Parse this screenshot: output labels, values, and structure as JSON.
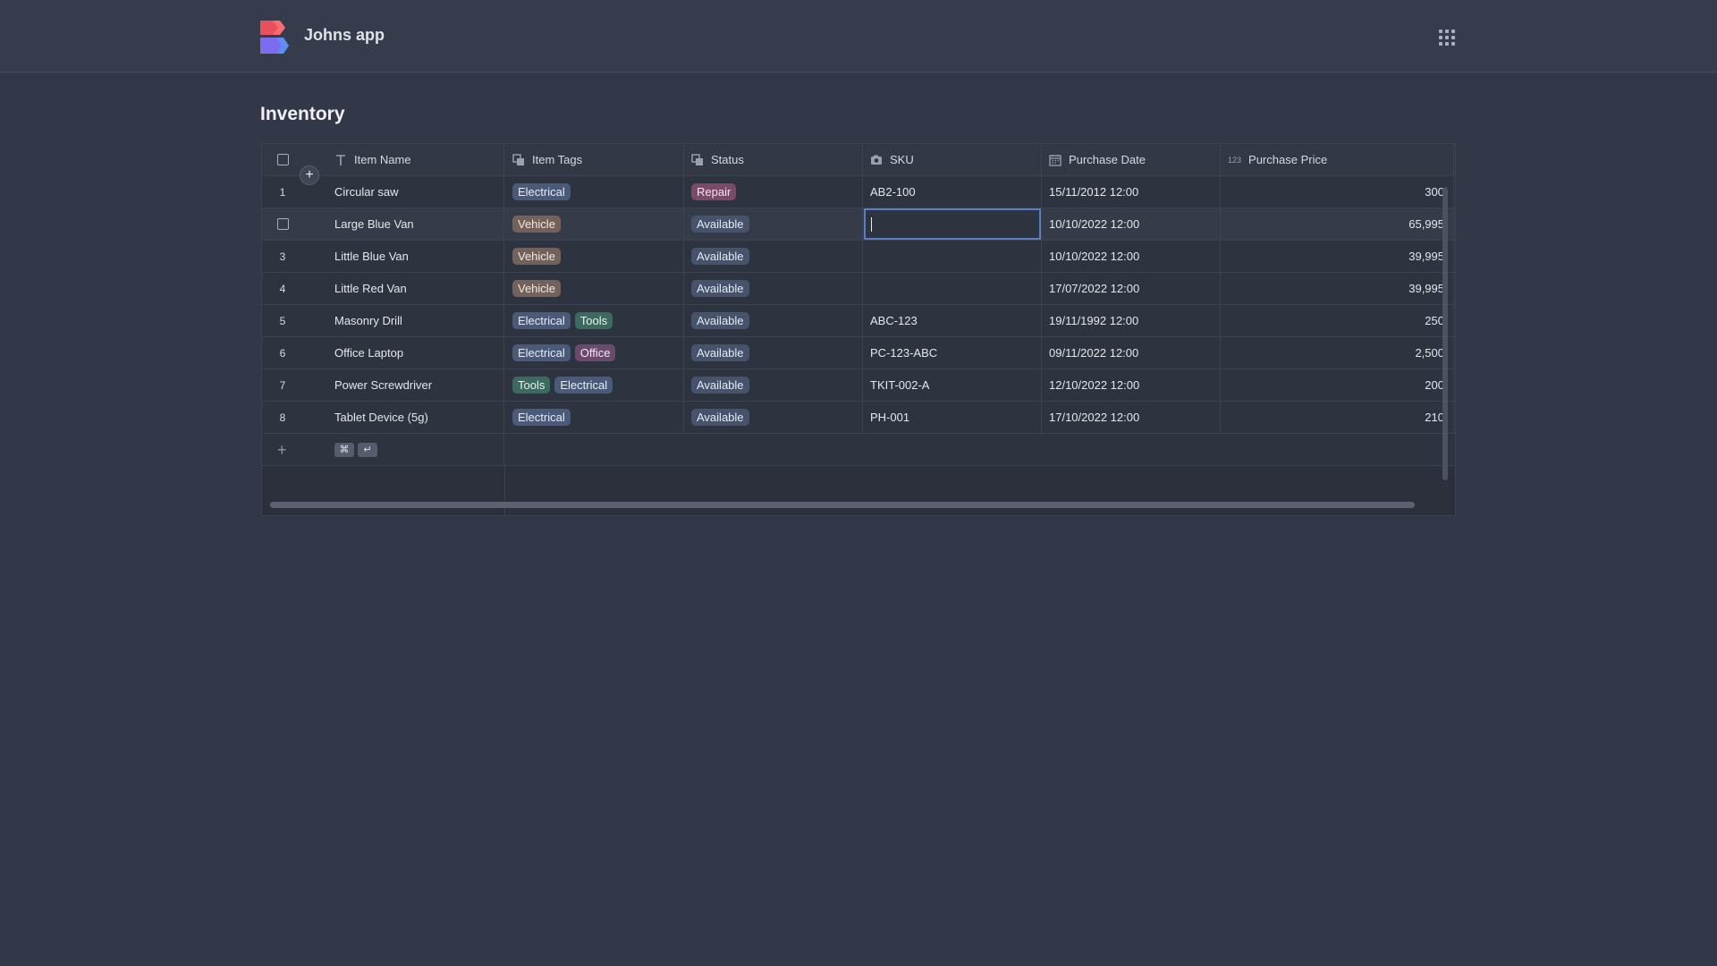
{
  "app": {
    "name": "Johns app"
  },
  "page": {
    "title": "Inventory"
  },
  "columns": [
    {
      "label": "Item Name",
      "icon": "text-type-icon"
    },
    {
      "label": "Item Tags",
      "icon": "multi-select-icon"
    },
    {
      "label": "Status",
      "icon": "single-select-icon"
    },
    {
      "label": "SKU",
      "icon": "camera-icon"
    },
    {
      "label": "Purchase Date",
      "icon": "calendar-icon"
    },
    {
      "label": "Purchase Price",
      "icon": "number-icon",
      "icon_text": "123"
    }
  ],
  "rows": [
    {
      "num": "1",
      "name": "Circular saw",
      "tags": [
        {
          "label": "Electrical",
          "kind": "electrical"
        }
      ],
      "status": {
        "label": "Repair",
        "kind": "repair"
      },
      "sku": "AB2-100",
      "date": "15/11/2012 12:00",
      "price": "300"
    },
    {
      "num": "",
      "name": "Large Blue Van",
      "tags": [
        {
          "label": "Vehicle",
          "kind": "vehicle"
        }
      ],
      "status": {
        "label": "Available",
        "kind": "available"
      },
      "sku": "",
      "date": "10/10/2022 12:00",
      "price": "65,995"
    },
    {
      "num": "3",
      "name": "Little Blue Van",
      "tags": [
        {
          "label": "Vehicle",
          "kind": "vehicle"
        }
      ],
      "status": {
        "label": "Available",
        "kind": "available"
      },
      "sku": "",
      "date": "10/10/2022 12:00",
      "price": "39,995"
    },
    {
      "num": "4",
      "name": "Little Red Van",
      "tags": [
        {
          "label": "Vehicle",
          "kind": "vehicle"
        }
      ],
      "status": {
        "label": "Available",
        "kind": "available"
      },
      "sku": "",
      "date": "17/07/2022 12:00",
      "price": "39,995"
    },
    {
      "num": "5",
      "name": "Masonry Drill",
      "tags": [
        {
          "label": "Electrical",
          "kind": "electrical"
        },
        {
          "label": "Tools",
          "kind": "tools"
        }
      ],
      "status": {
        "label": "Available",
        "kind": "available"
      },
      "sku": "ABC-123",
      "date": "19/11/1992 12:00",
      "price": "250"
    },
    {
      "num": "6",
      "name": "Office Laptop",
      "tags": [
        {
          "label": "Electrical",
          "kind": "electrical"
        },
        {
          "label": "Office",
          "kind": "office"
        }
      ],
      "status": {
        "label": "Available",
        "kind": "available"
      },
      "sku": "PC-123-ABC",
      "date": "09/11/2022 12:00",
      "price": "2,500"
    },
    {
      "num": "7",
      "name": "Power Screwdriver",
      "tags": [
        {
          "label": "Tools",
          "kind": "tools"
        },
        {
          "label": "Electrical",
          "kind": "electrical"
        }
      ],
      "status": {
        "label": "Available",
        "kind": "available"
      },
      "sku": "TKIT-002-A",
      "date": "12/10/2022 12:00",
      "price": "200"
    },
    {
      "num": "8",
      "name": "Tablet Device (5g)",
      "tags": [
        {
          "label": "Electrical",
          "kind": "electrical"
        }
      ],
      "status": {
        "label": "Available",
        "kind": "available"
      },
      "sku": "PH-001",
      "date": "17/10/2022 12:00",
      "price": "210"
    }
  ],
  "add_row": {
    "plus": "+",
    "shortcut_keys": [
      "⌘",
      "↵"
    ]
  },
  "colors": {
    "background": "#323847",
    "accent": "#5a7ec4",
    "logo_red": "#e8505b",
    "logo_purple": "#7b6cf0"
  }
}
